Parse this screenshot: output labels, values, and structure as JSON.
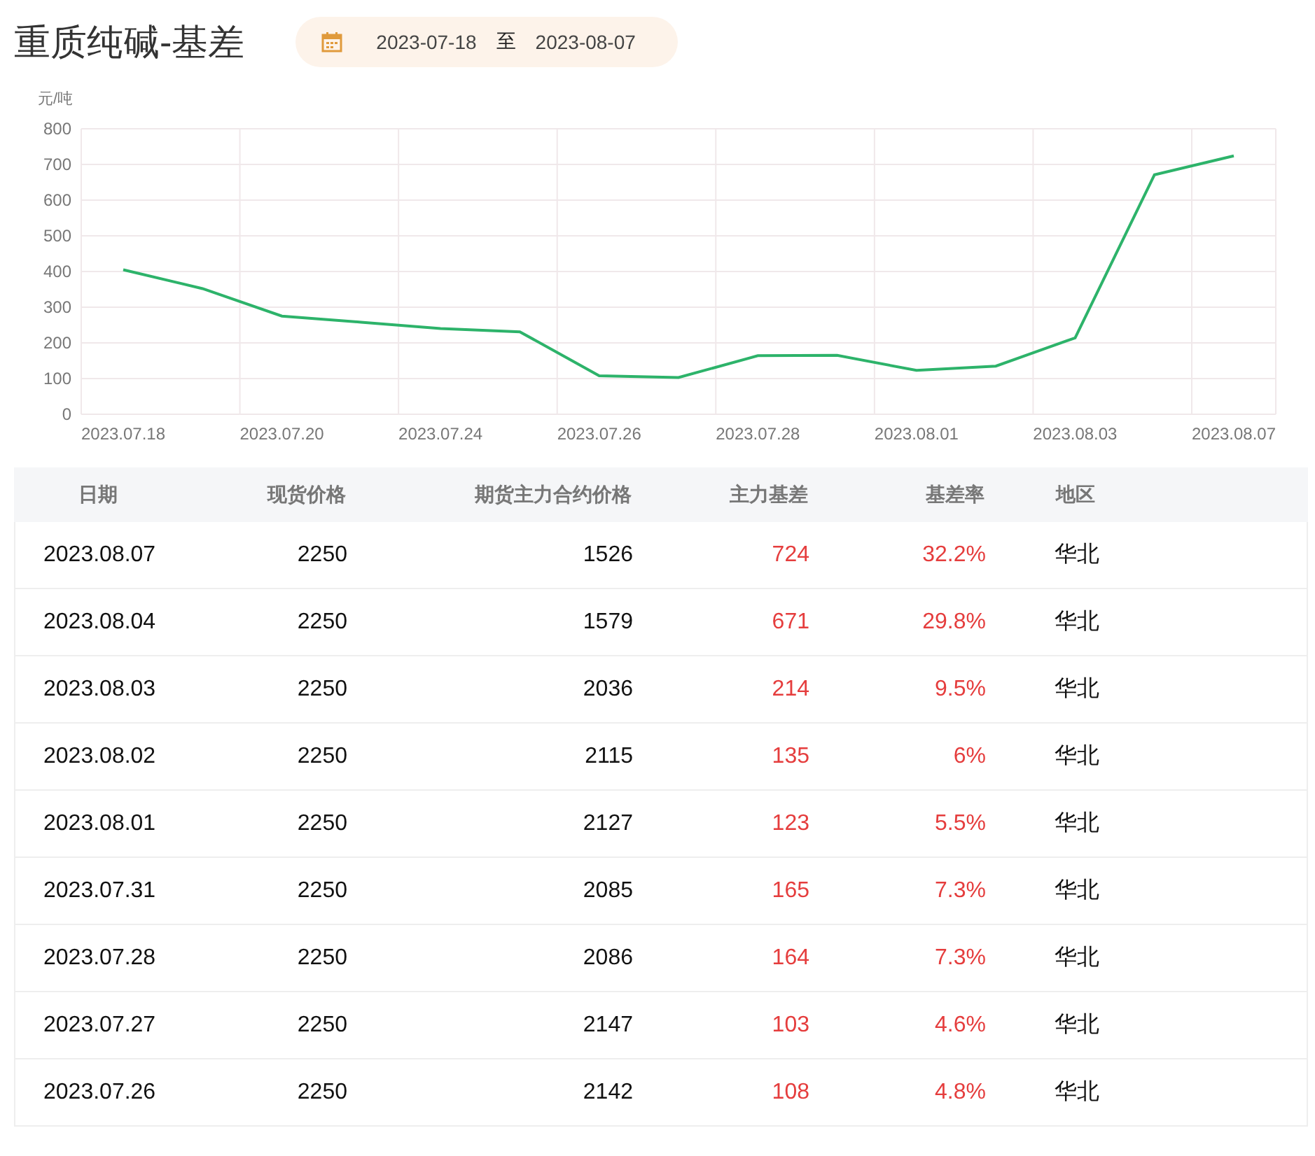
{
  "title": "重质纯碱-基差",
  "date_range": {
    "start": "2023-07-18",
    "separator": "至",
    "end": "2023-08-07"
  },
  "chart_data": {
    "type": "line",
    "ylabel": "元/吨",
    "grid": true,
    "categories": [
      "2023.07.18",
      null,
      "2023.07.20",
      null,
      "2023.07.24",
      null,
      "2023.07.26",
      null,
      "2023.07.28",
      null,
      "2023.08.01",
      null,
      "2023.08.03",
      null,
      "2023.08.07"
    ],
    "ylim": [
      0,
      800
    ],
    "yticks": [
      0,
      100,
      200,
      300,
      400,
      500,
      600,
      700,
      800
    ],
    "series": [
      {
        "color": "#2db36a",
        "values": [
          405,
          352,
          275,
          258,
          240,
          231,
          108,
          103,
          164,
          165,
          123,
          135,
          214,
          671,
          724
        ]
      }
    ]
  },
  "table": {
    "columns": [
      "日期",
      "现货价格",
      "期货主力合约价格",
      "主力基差",
      "基差率",
      "地区"
    ],
    "rows": [
      [
        "2023.08.07",
        "2250",
        "1526",
        "724",
        "32.2%",
        "华北"
      ],
      [
        "2023.08.04",
        "2250",
        "1579",
        "671",
        "29.8%",
        "华北"
      ],
      [
        "2023.08.03",
        "2250",
        "2036",
        "214",
        "9.5%",
        "华北"
      ],
      [
        "2023.08.02",
        "2250",
        "2115",
        "135",
        "6%",
        "华北"
      ],
      [
        "2023.08.01",
        "2250",
        "2127",
        "123",
        "5.5%",
        "华北"
      ],
      [
        "2023.07.31",
        "2250",
        "2085",
        "165",
        "7.3%",
        "华北"
      ],
      [
        "2023.07.28",
        "2250",
        "2086",
        "164",
        "7.3%",
        "华北"
      ],
      [
        "2023.07.27",
        "2250",
        "2147",
        "103",
        "4.6%",
        "华北"
      ],
      [
        "2023.07.26",
        "2250",
        "2142",
        "108",
        "4.8%",
        "华北"
      ]
    ]
  }
}
